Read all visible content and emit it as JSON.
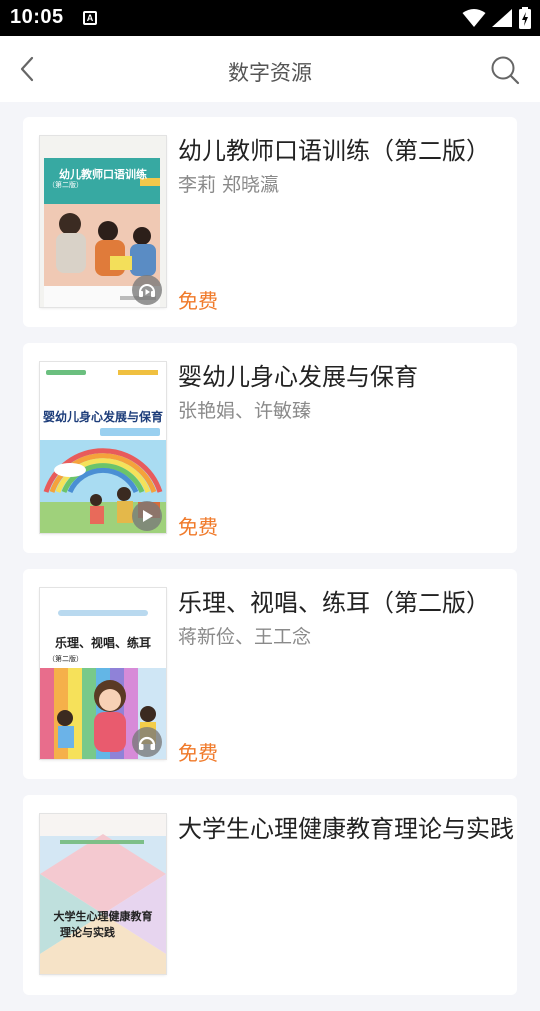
{
  "status_bar": {
    "time": "10:05",
    "a_badge": "A"
  },
  "header": {
    "title": "数字资源"
  },
  "books": [
    {
      "title": "幼儿教师口语训练（第二版）",
      "author": "李莉 郑晓瀛",
      "price": "免费",
      "media": "audio-video",
      "cover_title": "幼儿教师口语训练",
      "cover_subtitle": "（第二版）"
    },
    {
      "title": "婴幼儿身心发展与保育",
      "author": "张艳娟、许敏臻",
      "price": "免费",
      "media": "video",
      "cover_title": "婴幼儿身心发展与保育"
    },
    {
      "title": "乐理、视唱、练耳（第二版）",
      "author": "蒋新俭、王工念",
      "price": "免费",
      "media": "audio",
      "cover_title": "乐理、视唱、练耳",
      "cover_subtitle": "（第二版）"
    },
    {
      "title": "大学生心理健康教育理论与实践",
      "author": "",
      "price": "",
      "cover_title": "大学生心理健康教育",
      "cover_title2": "理论与实践"
    }
  ],
  "colors": {
    "price": "#f07a2a",
    "background": "#f4f5f9"
  }
}
